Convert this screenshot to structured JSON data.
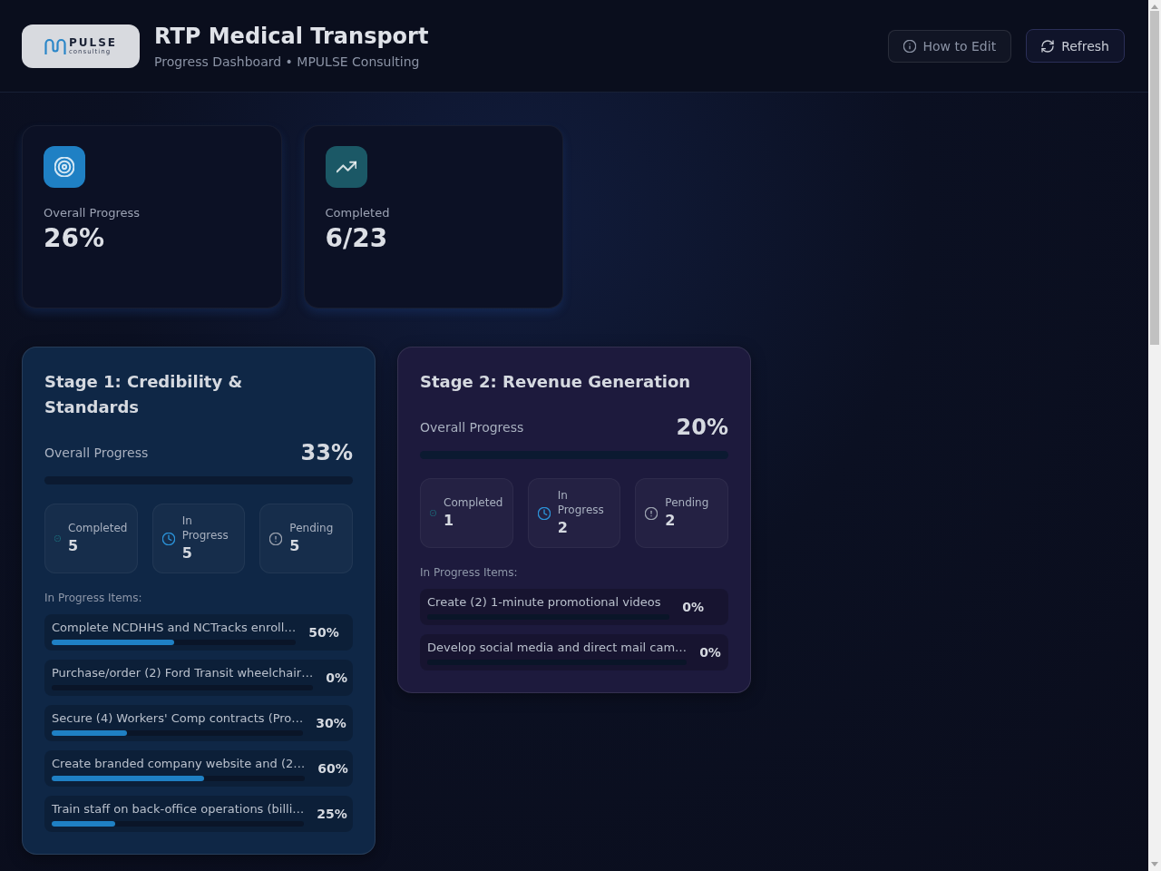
{
  "header": {
    "logo": {
      "wordmark": "PULSE",
      "tagline": "consulting"
    },
    "title": "RTP Medical Transport",
    "subtitle": "Progress Dashboard • MPULSE Consulting",
    "buttons": [
      {
        "label": "How to Edit",
        "kind": "info"
      },
      {
        "label": "Refresh",
        "kind": "refresh"
      }
    ]
  },
  "summary_cards": [
    {
      "label": "Overall Progress",
      "value": "26%",
      "color": "#1f80c4"
    },
    {
      "label": "Completed",
      "value": "6/23",
      "color": "#1b5866"
    }
  ],
  "stages": [
    {
      "title": "Stage 1: Credibility & Standards",
      "color": "#0f2746",
      "overall_label": "Overall Progress",
      "overall_value": "33%",
      "stats": [
        {
          "label": "Completed",
          "value": "5"
        },
        {
          "label": "In Progress",
          "value": "5"
        },
        {
          "label": "Pending",
          "value": "5"
        }
      ],
      "items_heading": "In Progress Items:",
      "items": [
        {
          "text": "Complete NCDHHS and NCTracks enroll…",
          "percent": "50%",
          "level": 0.5
        },
        {
          "text": "Purchase/order (2) Ford Transit wheelchair…",
          "percent": "0%"
        },
        {
          "text": "Secure (4) Workers' Comp contracts (Pro…",
          "percent": "30%",
          "level": 0.3
        },
        {
          "text": "Create branded company website and (2…",
          "percent": "60%",
          "level": 0.6
        },
        {
          "text": "Train staff on back-office operations (billi…",
          "percent": "25%",
          "level": 0.25
        }
      ]
    },
    {
      "title": "Stage 2: Revenue Generation",
      "color": "#1d1a3d",
      "overall_label": "Overall Progress",
      "overall_value": "20%",
      "stats": [
        {
          "label": "Completed",
          "value": "1"
        },
        {
          "label": "In Progress",
          "value": "2"
        },
        {
          "label": "Pending",
          "value": "2"
        }
      ],
      "items_heading": "In Progress Items:",
      "items": [
        {
          "text": "Create (2) 1-minute promotional videos",
          "percent": "0%"
        },
        {
          "text": "Develop social media and direct mail cam…",
          "percent": "0%"
        }
      ]
    }
  ]
}
